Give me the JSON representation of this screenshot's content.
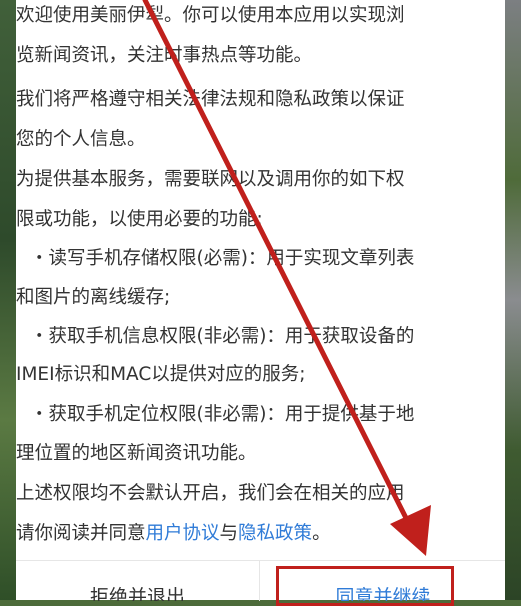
{
  "dialog": {
    "intro_line1": "欢迎使用美丽伊犁。你可以使用本应用以实现浏",
    "intro_line2": "览新闻资讯，关注时事热点等功能。",
    "law_line1": "我们将严格遵守相关法律法规和隐私政策以保证",
    "law_line2": "您的个人信息。",
    "need_line1": "为提供基本服务，需要联网以及调用你的如下权",
    "need_line2": "限或功能，以使用必要的功能:",
    "perm_storage_line1": "・读写手机存储权限(必需)：用于实现文章列表",
    "perm_storage_line2": "和图片的离线缓存;",
    "perm_device_line1": "・获取手机信息权限(非必需)：用于获取设备的",
    "perm_device_line2": "IMEI标识和MAC以提供对应的服务;",
    "perm_location_line1": "・获取手机定位权限(非必需)：用于提供基于地",
    "perm_location_line2": "理位置的地区新闻资讯功能。",
    "default_line": "上述权限均不会默认开启，我们会在相关的应用",
    "read_prefix": "请你阅读并同意",
    "user_agreement": "用户协议",
    "and": "与",
    "privacy_policy": "隐私政策",
    "read_suffix": "。"
  },
  "buttons": {
    "reject": "拒绝并退出",
    "accept": "同意并继续"
  },
  "colors": {
    "link": "#2f7bd7",
    "annotation_red": "#c0201c"
  }
}
